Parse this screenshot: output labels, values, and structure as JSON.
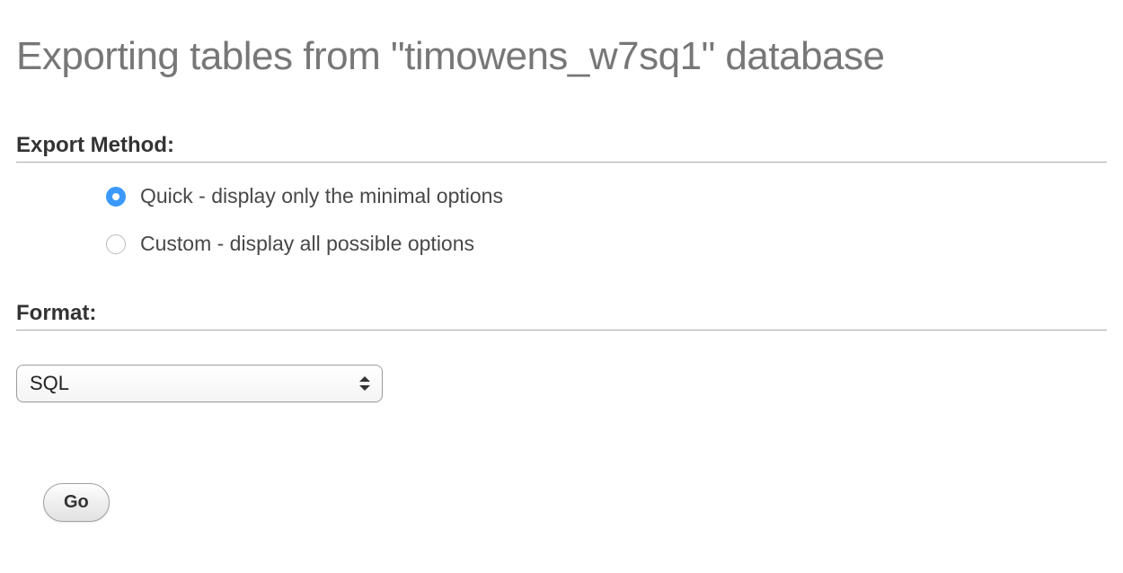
{
  "page_title": "Exporting tables from \"timowens_w7sq1\" database",
  "export_method": {
    "heading": "Export Method:",
    "options": [
      {
        "label": "Quick - display only the minimal options",
        "checked": true
      },
      {
        "label": "Custom - display all possible options",
        "checked": false
      }
    ]
  },
  "format": {
    "heading": "Format:",
    "selected": "SQL"
  },
  "go_button_label": "Go"
}
